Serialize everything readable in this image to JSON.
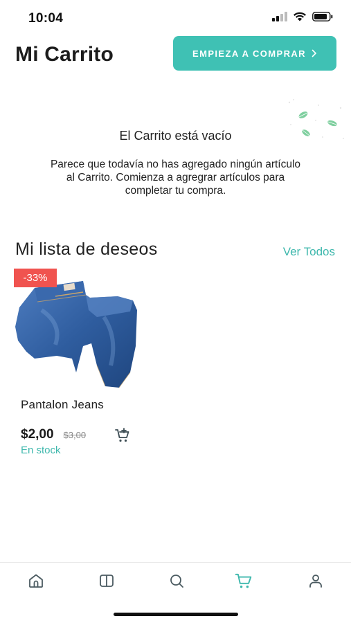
{
  "status_bar": {
    "time": "10:04"
  },
  "header": {
    "title": "Mi Carrito",
    "shop_button_label": "EMPIEZA A COMPRAR"
  },
  "empty_cart": {
    "title": "El Carrito está vacío",
    "line1": "Parece que todavía no has agregado ningún artículo",
    "line2": "al Carrito. Comienza a agregrar artículos para",
    "line3": "completar tu compra."
  },
  "wishlist": {
    "title": "Mi lista de deseos",
    "view_all": "Ver Todos",
    "products": [
      {
        "name": "Pantalon Jeans",
        "badge": "-33%",
        "price": "$2,00",
        "old_price": "$3,00",
        "stock": "En stock"
      }
    ]
  },
  "bottom_nav": {
    "items": [
      {
        "icon": "home-icon",
        "active": false
      },
      {
        "icon": "catalog-icon",
        "active": false
      },
      {
        "icon": "search-icon",
        "active": false
      },
      {
        "icon": "cart-icon",
        "active": true
      },
      {
        "icon": "user-icon",
        "active": false
      }
    ]
  },
  "colors": {
    "accent": "#3fc1b4",
    "badge": "#f0534f",
    "nav_inactive": "#4a5a60",
    "nav_active": "#3fb8ad"
  }
}
